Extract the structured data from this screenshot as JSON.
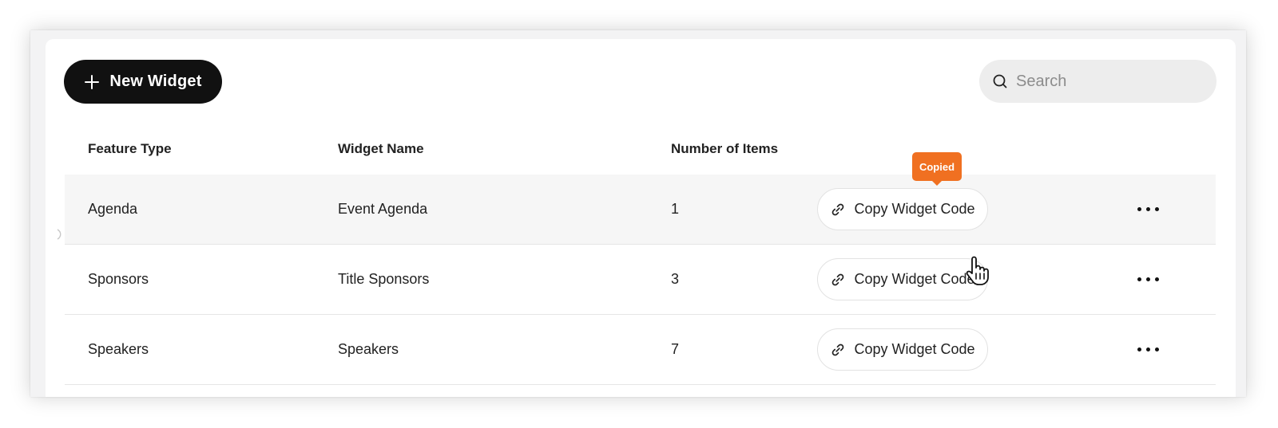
{
  "toolbar": {
    "new_widget_label": "New Widget",
    "search_placeholder": "Search"
  },
  "table": {
    "headers": {
      "feature_type": "Feature Type",
      "widget_name": "Widget Name",
      "number_of_items": "Number of Items"
    },
    "rows": [
      {
        "feature_type": "Agenda",
        "widget_name": "Event Agenda",
        "count": "1",
        "copy_label": "Copy Widget Code"
      },
      {
        "feature_type": "Sponsors",
        "widget_name": "Title Sponsors",
        "count": "3",
        "copy_label": "Copy Widget Code"
      },
      {
        "feature_type": "Speakers",
        "widget_name": "Speakers",
        "count": "7",
        "copy_label": "Copy Widget Code"
      }
    ]
  },
  "tooltip": {
    "text": "Copied"
  },
  "icons": {
    "new_widget": "plus-icon",
    "search": "search-icon",
    "copy": "link-icon",
    "more": "more-horizontal-icon",
    "cursor": "hand-pointer-icon"
  },
  "colors": {
    "primary_button": "#111111",
    "tooltip_accent": "#f07021",
    "row_hover": "#f6f6f6",
    "search_bg": "#ededed"
  }
}
